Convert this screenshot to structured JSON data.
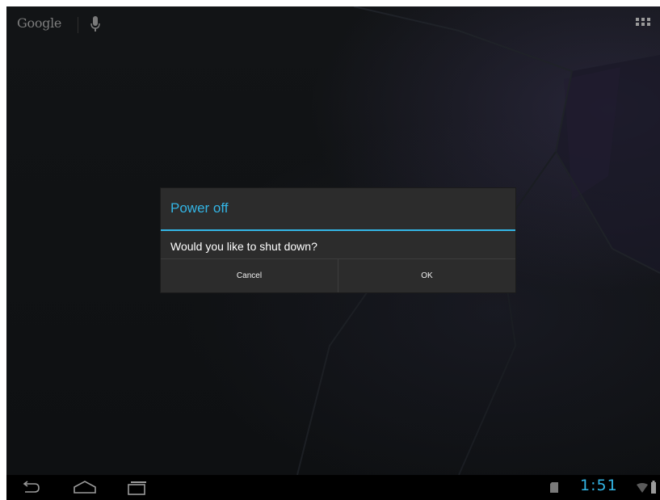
{
  "homescreen": {
    "search_label": "Google",
    "icons": {
      "mic": "microphone-icon",
      "apps": "all-apps-grid-icon"
    }
  },
  "dialog": {
    "title": "Power off",
    "message": "Would you like to shut down?",
    "cancel_label": "Cancel",
    "ok_label": "OK"
  },
  "system_bar": {
    "time": "1:51",
    "icons": [
      "back-icon",
      "home-icon",
      "recent-apps-icon",
      "sd-card-icon",
      "wifi-icon",
      "battery-icon"
    ]
  },
  "colors": {
    "accent": "#33b5e5",
    "dialog_bg": "#2c2c2c",
    "screen_bg": "#0d0f11",
    "nav_bg": "#000000"
  }
}
